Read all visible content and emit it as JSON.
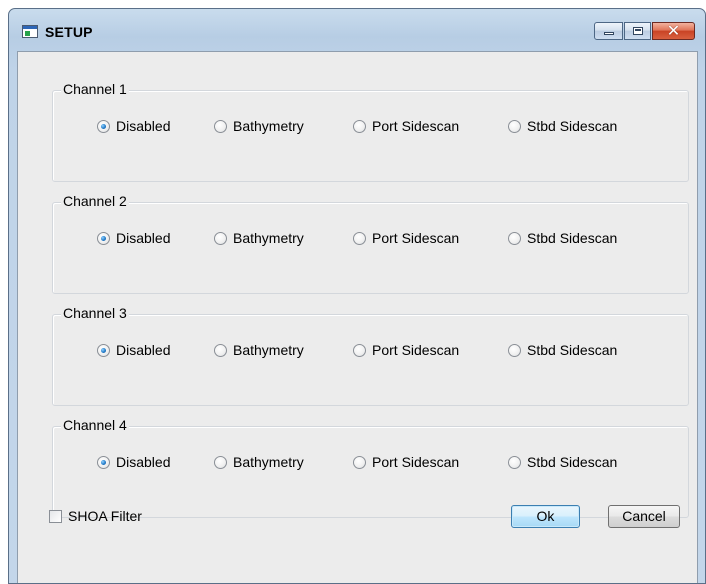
{
  "window": {
    "title": "SETUP",
    "icon": "app-window-icon",
    "controls": [
      "minimize-icon",
      "maximize-icon",
      "close-icon"
    ]
  },
  "channels": [
    {
      "label": "Channel 1",
      "options": [
        "Disabled",
        "Bathymetry",
        "Port Sidescan",
        "Stbd Sidescan"
      ],
      "selected": "Disabled"
    },
    {
      "label": "Channel 2",
      "options": [
        "Disabled",
        "Bathymetry",
        "Port Sidescan",
        "Stbd Sidescan"
      ],
      "selected": "Disabled"
    },
    {
      "label": "Channel 3",
      "options": [
        "Disabled",
        "Bathymetry",
        "Port Sidescan",
        "Stbd Sidescan"
      ],
      "selected": "Disabled"
    },
    {
      "label": "Channel 4",
      "options": [
        "Disabled",
        "Bathymetry",
        "Port Sidescan",
        "Stbd Sidescan"
      ],
      "selected": "Disabled"
    }
  ],
  "filter": {
    "label": "SHOA Filter",
    "checked": false
  },
  "buttons": {
    "ok": "Ok",
    "cancel": "Cancel"
  },
  "colors": {
    "accent": "#3c7fb1",
    "titlebar": "#b7cde4",
    "close": "#c94325",
    "client": "#ececec"
  }
}
